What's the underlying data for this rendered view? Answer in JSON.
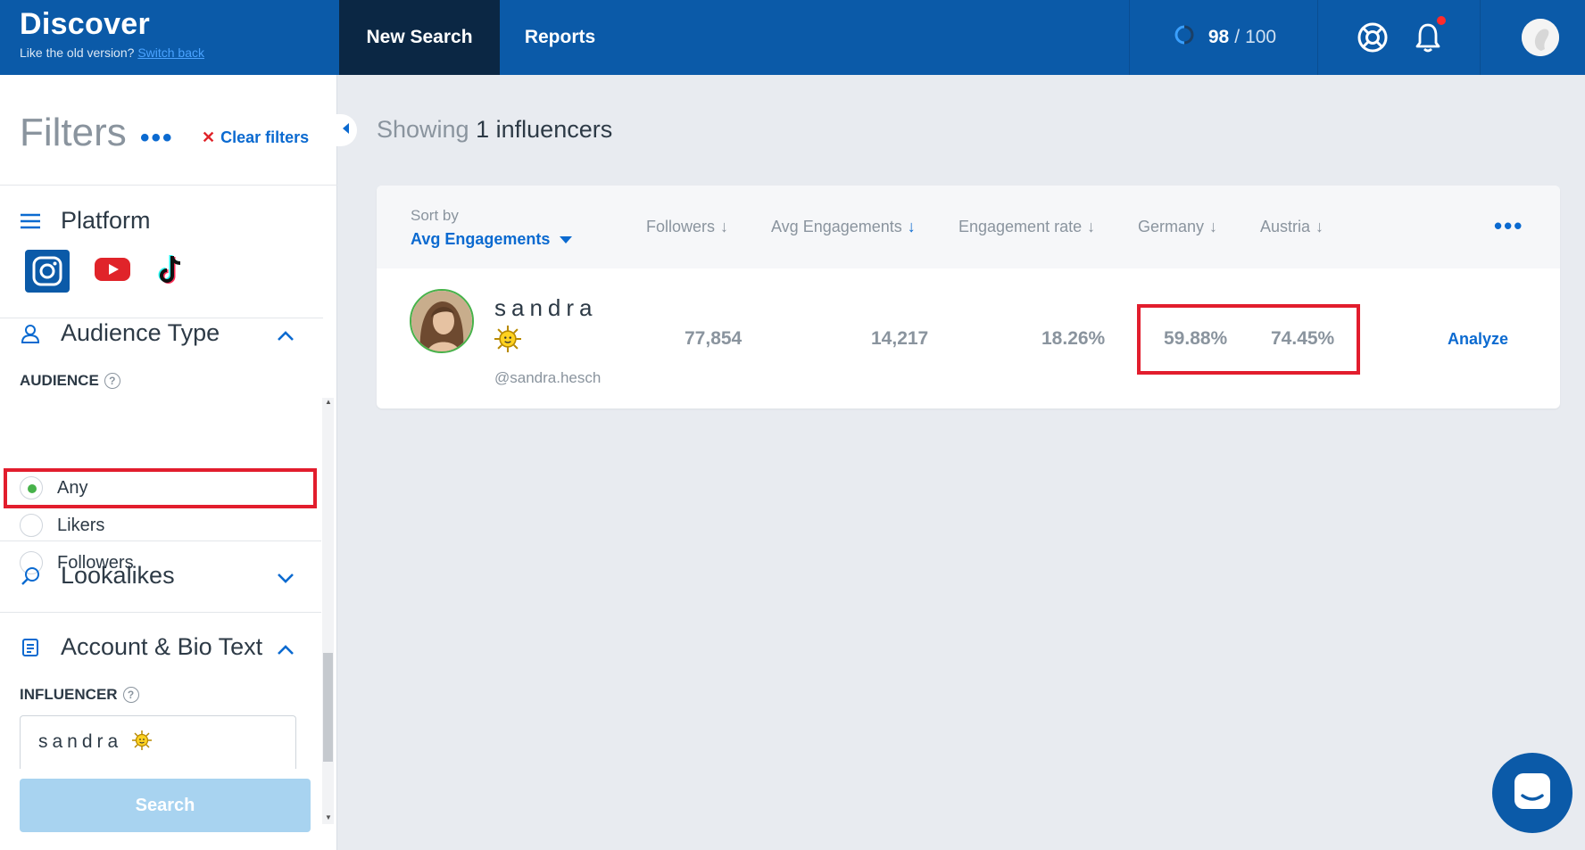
{
  "brand": {
    "title": "Discover",
    "subtitle": "Like the old version?",
    "switch_back": "Switch back"
  },
  "nav": {
    "new_search": "New Search",
    "reports": "Reports"
  },
  "credits": {
    "used": "98",
    "separator": "/",
    "total": "100"
  },
  "sidebar": {
    "filters_title": "Filters",
    "more": "•••",
    "clear_filters": "Clear filters",
    "platform": {
      "label": "Platform",
      "icons": [
        "instagram-icon",
        "youtube-icon",
        "tiktok-icon"
      ]
    },
    "audience_type": {
      "label": "Audience Type",
      "sub_label": "AUDIENCE",
      "options": [
        "Any",
        "Likers",
        "Followers"
      ],
      "selected": "Any"
    },
    "lookalikes": {
      "label": "Lookalikes"
    },
    "account_bio": {
      "label": "Account & Bio Text",
      "sub_label": "INFLUENCER",
      "value": "sandra"
    },
    "search_button": "Search"
  },
  "main": {
    "showing_prefix": "Showing",
    "count": "1",
    "showing_suffix": "influencers",
    "table": {
      "sort_by_label": "Sort by",
      "sort_by_value": "Avg Engagements",
      "columns": [
        "Followers",
        "Avg Engagements",
        "Engagement rate",
        "Germany",
        "Austria"
      ],
      "more": "•••",
      "rows": [
        {
          "name": "sandra",
          "handle": "@sandra.hesch",
          "followers": "77,854",
          "avg_engagements": "14,217",
          "engagement_rate": "18.26%",
          "germany": "59.88%",
          "austria": "74.45%",
          "action": "Analyze"
        }
      ]
    }
  },
  "colors": {
    "topbar": "#0b5aa8",
    "active_tab": "#0b2744",
    "accent": "#0b6ad0",
    "highlight": "#e21d2d",
    "radio_selected": "#47b24a"
  }
}
